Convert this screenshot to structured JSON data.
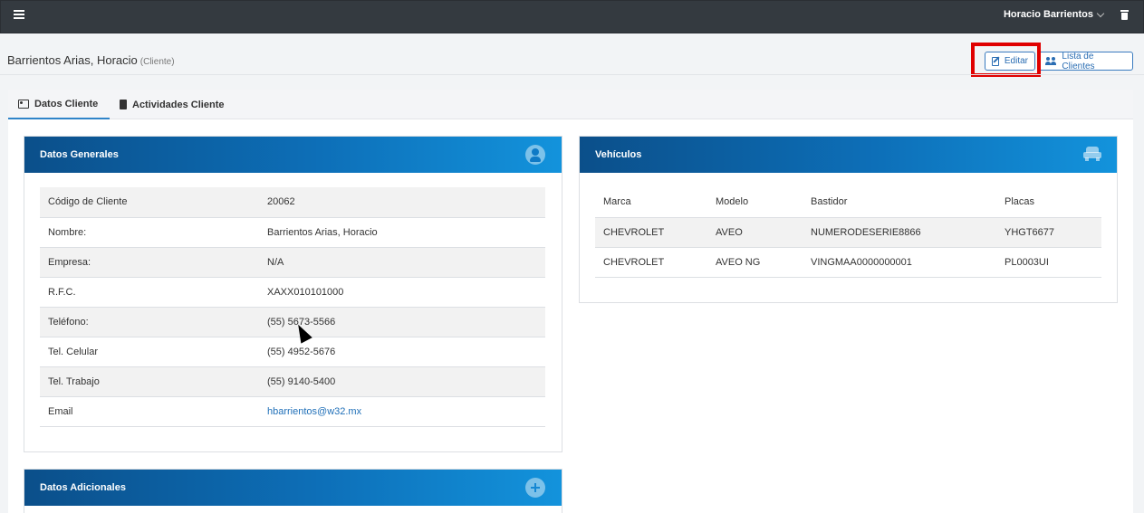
{
  "topbar": {
    "user_name": "Horacio Barrientos"
  },
  "header": {
    "title": "Barrientos Arias, Horacio",
    "subtitle": "(Cliente)",
    "edit_label": "Editar",
    "list_label": "Lista de Clientes"
  },
  "tabs": [
    {
      "label": "Datos Cliente",
      "active": true
    },
    {
      "label": "Actividades Cliente",
      "active": false
    }
  ],
  "general": {
    "title": "Datos Generales",
    "rows": [
      {
        "label": "Código de Cliente",
        "value": "20062"
      },
      {
        "label": "Nombre:",
        "value": "Barrientos Arias, Horacio"
      },
      {
        "label": "Empresa:",
        "value": "N/A"
      },
      {
        "label": "R.F.C.",
        "value": "XAXX010101000"
      },
      {
        "label": "Teléfono:",
        "value": "(55) 5673-5566"
      },
      {
        "label": "Tel. Celular",
        "value": "(55) 4952-5676"
      },
      {
        "label": "Tel. Trabajo",
        "value": "(55) 9140-5400"
      },
      {
        "label": "Email",
        "value": "hbarrientos@w32.mx"
      }
    ]
  },
  "vehicles": {
    "title": "Vehículos",
    "columns": [
      "Marca",
      "Modelo",
      "Bastidor",
      "Placas"
    ],
    "rows": [
      [
        "CHEVROLET",
        "AVEO",
        "NUMERODESERIE8866",
        "YHGT6677"
      ],
      [
        "CHEVROLET",
        "AVEO NG",
        "VINGMAA0000000001",
        "PL0003UI"
      ]
    ]
  },
  "additional": {
    "title": "Datos Adicionales"
  },
  "colors": {
    "accent": "#2f84c8",
    "topbar": "#343a40",
    "highlight": "#e00000"
  },
  "icons": [
    "menu-icon",
    "chevron-down-icon",
    "trash-icon",
    "edit-icon",
    "users-icon",
    "id-card-icon",
    "document-icon",
    "user-circle-icon",
    "car-icon",
    "plus-circle-icon"
  ]
}
